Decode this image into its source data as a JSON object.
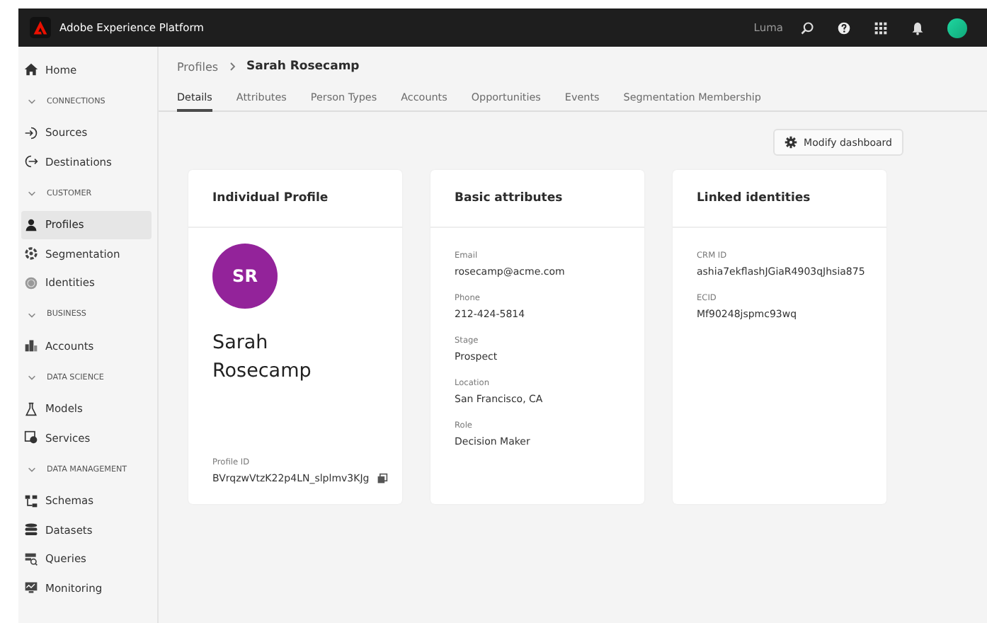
{
  "topbar": {
    "title": "Adobe Experience Platform",
    "org": "Luma"
  },
  "sidebar": {
    "items": [
      {
        "label": "Home",
        "selected": false
      }
    ],
    "sections": [
      {
        "title": "CONNECTIONS",
        "expanded": true,
        "items": [
          {
            "label": "Sources",
            "selected": false
          },
          {
            "label": "Destinations",
            "selected": false
          }
        ]
      },
      {
        "title": "CUSTOMER",
        "expanded": true,
        "items": [
          {
            "label": "Profiles",
            "selected": true
          },
          {
            "label": "Segmentation",
            "selected": false
          },
          {
            "label": "Identities",
            "selected": false
          }
        ]
      },
      {
        "title": "BUSINESS",
        "expanded": true,
        "items": [
          {
            "label": "Accounts",
            "selected": false
          }
        ]
      },
      {
        "title": "DATA SCIENCE",
        "expanded": true,
        "items": [
          {
            "label": "Models",
            "selected": false
          },
          {
            "label": "Services",
            "selected": false
          }
        ]
      },
      {
        "title": "DATA MANAGEMENT",
        "expanded": true,
        "items": [
          {
            "label": "Schemas",
            "selected": false
          },
          {
            "label": "Datasets",
            "selected": false
          },
          {
            "label": "Queries",
            "selected": false
          },
          {
            "label": "Monitoring",
            "selected": false
          }
        ]
      }
    ]
  },
  "breadcrumb": {
    "parent": "Profiles",
    "current": "Sarah Rosecamp"
  },
  "tabs": [
    {
      "label": "Details",
      "selected": true
    },
    {
      "label": "Attributes",
      "selected": false
    },
    {
      "label": "Person Types",
      "selected": false
    },
    {
      "label": "Accounts",
      "selected": false
    },
    {
      "label": "Opportunities",
      "selected": false
    },
    {
      "label": "Events",
      "selected": false
    },
    {
      "label": "Segmentation Membership",
      "selected": false
    }
  ],
  "modify_button": "Modify dashboard",
  "cards": [
    {
      "kind": "profile",
      "title": "Individual Profile",
      "initials": "SR",
      "color": "#93239a",
      "name": "Sarah Rosecamp",
      "id_label": "Profile ID",
      "id_value": "BVrqzwVtzK22p4LN_slplmv3KJg"
    },
    {
      "kind": "fields",
      "title": "Basic attributes",
      "fields": [
        {
          "label": "Email",
          "value": "rosecamp@acme.com"
        },
        {
          "label": "Phone",
          "value": "212-424-5814"
        },
        {
          "label": "Stage",
          "value": "Prospect"
        },
        {
          "label": "Location",
          "value": "San Francisco, CA"
        },
        {
          "label": "Role",
          "value": "Decision Maker"
        }
      ]
    },
    {
      "kind": "fields",
      "title": "Linked identities",
      "fields": [
        {
          "label": "CRM ID",
          "value": "ashia7ekflashJGiaR4903qJhsia875"
        },
        {
          "label": "ECID",
          "value": "Mf90248jspmc93wq"
        }
      ]
    }
  ]
}
